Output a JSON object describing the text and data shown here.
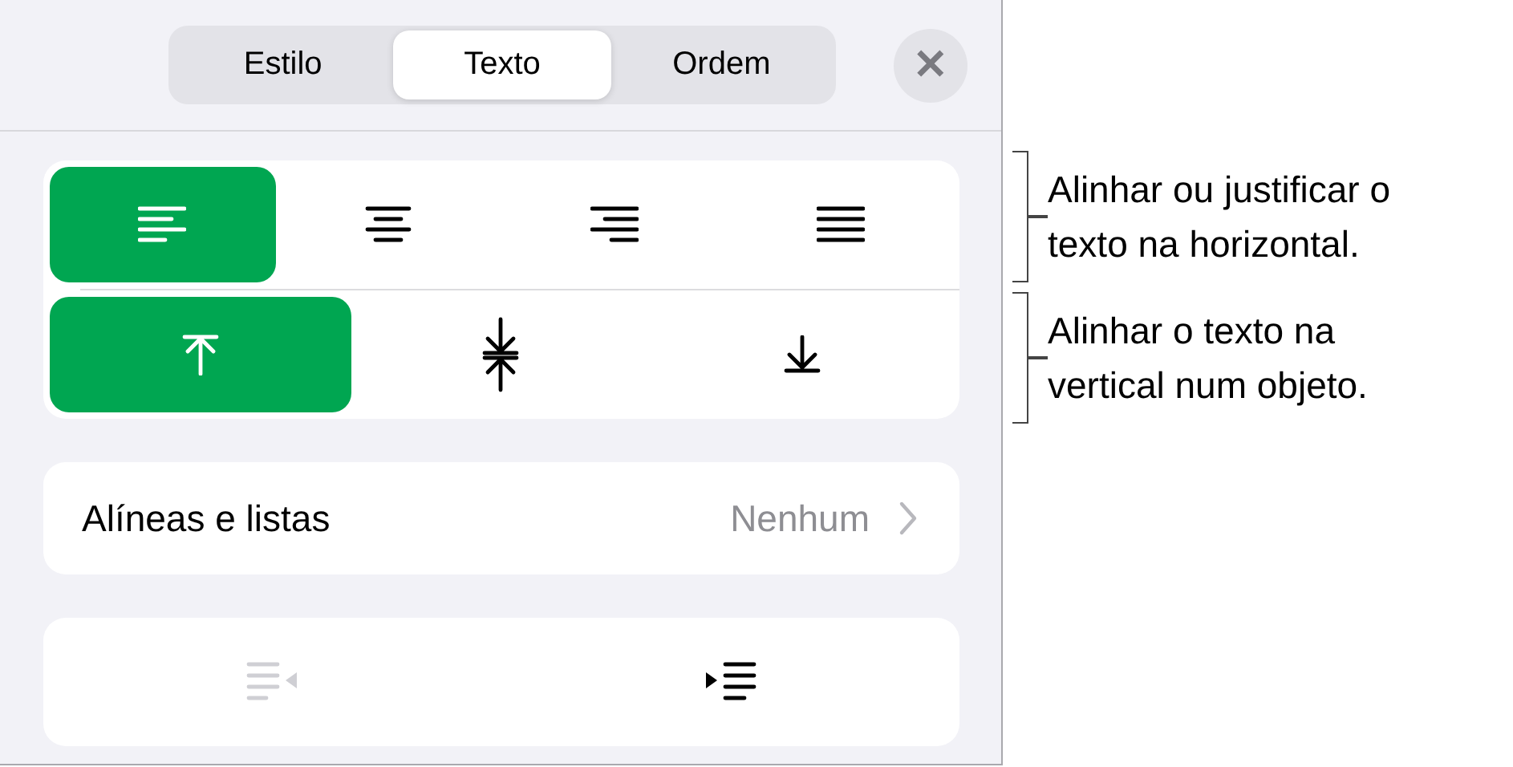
{
  "tabs": [
    {
      "label": "Estilo",
      "selected": false
    },
    {
      "label": "Texto",
      "selected": true
    },
    {
      "label": "Ordem",
      "selected": false
    }
  ],
  "close_button": {
    "label": "✕"
  },
  "horizontal_alignment": [
    {
      "kind": "left",
      "selected": true
    },
    {
      "kind": "center",
      "selected": false
    },
    {
      "kind": "right",
      "selected": false
    },
    {
      "kind": "justify",
      "selected": false
    }
  ],
  "vertical_alignment": [
    {
      "kind": "top",
      "selected": true
    },
    {
      "kind": "middle",
      "selected": false
    },
    {
      "kind": "bottom",
      "selected": false
    }
  ],
  "bullets_row": {
    "label": "Alíneas e listas",
    "value": "Nenhum"
  },
  "indent_buttons": [
    {
      "kind": "decrease",
      "disabled": true
    },
    {
      "kind": "increase",
      "disabled": false
    }
  ],
  "callouts": [
    {
      "lines": [
        "Alinhar ou justificar o",
        "texto na horizontal."
      ]
    },
    {
      "lines": [
        "Alinhar o texto na",
        "vertical num objeto."
      ]
    }
  ]
}
